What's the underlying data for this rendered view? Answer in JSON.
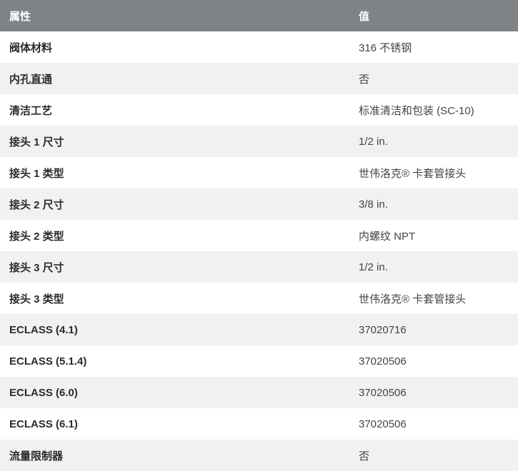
{
  "table": {
    "headers": {
      "attribute": "属性",
      "value": "值"
    },
    "rows": [
      {
        "attribute": "阀体材料",
        "value": "316 不锈钢"
      },
      {
        "attribute": "内孔直通",
        "value": "否"
      },
      {
        "attribute": "清洁工艺",
        "value": "标准清洁和包装 (SC-10)"
      },
      {
        "attribute": "接头 1 尺寸",
        "value": "1/2 in."
      },
      {
        "attribute": "接头 1 类型",
        "value": "世伟洛克® 卡套管接头"
      },
      {
        "attribute": "接头 2 尺寸",
        "value": "3/8 in."
      },
      {
        "attribute": "接头 2 类型",
        "value": "内螺纹 NPT"
      },
      {
        "attribute": "接头 3 尺寸",
        "value": "1/2 in."
      },
      {
        "attribute": "接头 3 类型",
        "value": "世伟洛克® 卡套管接头"
      },
      {
        "attribute": "ECLASS (4.1)",
        "value": "37020716"
      },
      {
        "attribute": "ECLASS (5.1.4)",
        "value": "37020506"
      },
      {
        "attribute": "ECLASS (6.0)",
        "value": "37020506"
      },
      {
        "attribute": "ECLASS (6.1)",
        "value": "37020506"
      },
      {
        "attribute": "流量限制器",
        "value": "否"
      }
    ]
  },
  "colors": {
    "header_bg": "#7f8286",
    "header_text": "#ffffff",
    "row_alt_bg": "#f1f1f2",
    "row_bg": "#ffffff"
  }
}
